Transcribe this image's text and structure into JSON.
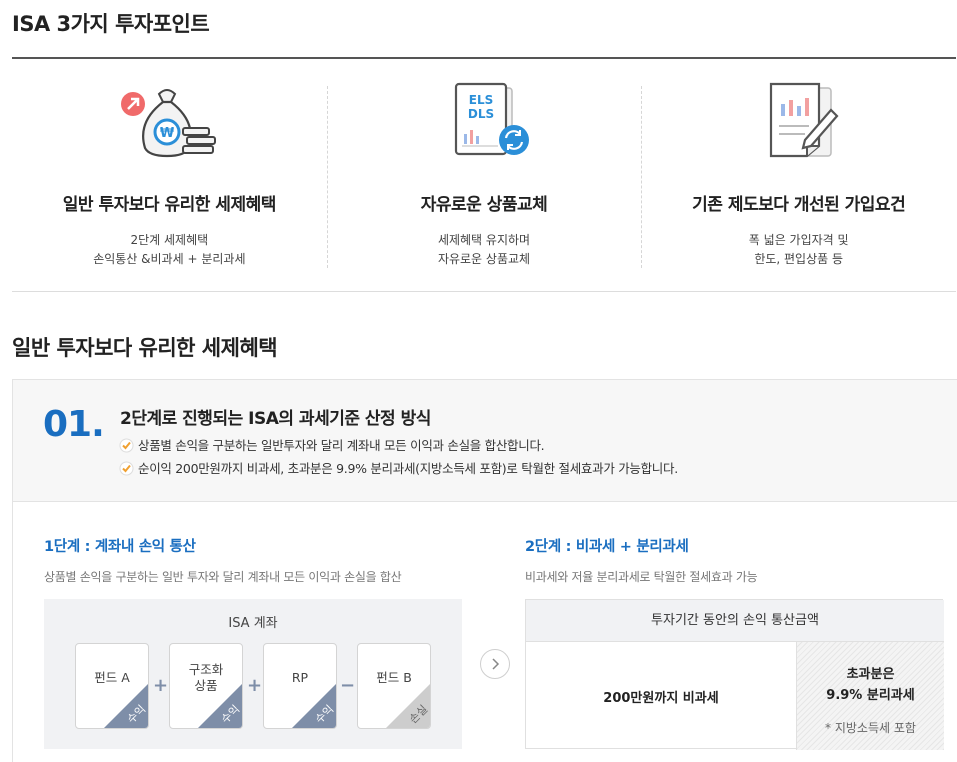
{
  "page_title": "ISA 3가지 투자포인트",
  "points": [
    {
      "heading": "일반 투자보다 유리한 세제혜택",
      "desc": [
        "2단계 세제혜택",
        "손익통산 &비과세 + 분리과세"
      ],
      "icon": "money-bag-icon"
    },
    {
      "heading": "자유로운 상품교체",
      "desc": [
        "세제혜택 유지하며",
        "자유로운 상품교체"
      ],
      "icon_text": [
        "ELS",
        "DLS"
      ],
      "icon": "els-dls-exchange-icon"
    },
    {
      "heading": "기존 제도보다 개선된 가입요건",
      "desc": [
        "폭 넓은 가입자격 및",
        "한도, 편입상품 등"
      ],
      "icon": "document-edit-icon"
    }
  ],
  "section_title": "일반 투자보다 유리한 세제혜택",
  "panel": {
    "step_no": "01.",
    "title": "2단계로 진행되는 ISA의 과세기준 산정 방식",
    "bullets": [
      "상품별 손익을 구분하는 일반투자와 달리 계좌내 모든 이익과 손실을 합산합니다.",
      "순이익 200만원까지 비과세, 초과분은 9.9% 분리과세(지방소득세 포함)로 탁월한 절세효과가 가능합니다."
    ],
    "stage1": {
      "title": "1단계 : 계좌내 손익 통산",
      "desc": "상품별 손익을 구분하는 일반 투자와 달리 계좌내 모든 이익과 손실을 합산",
      "box_label": "ISA 계좌",
      "cards": [
        {
          "label": "펀드 A",
          "tag": "수익",
          "kind": "gain"
        },
        {
          "label": "구조화\n상품",
          "tag": "수익",
          "kind": "gain"
        },
        {
          "label": "RP",
          "tag": "수익",
          "kind": "gain"
        },
        {
          "label": "펀드 B",
          "tag": "손실",
          "kind": "loss"
        }
      ],
      "ops": [
        "+",
        "+",
        "−"
      ]
    },
    "stage2": {
      "title": "2단계 : 비과세 + 분리과세",
      "desc": "비과세와 저율 분리과세로 탁월한 절세효과 가능",
      "head": "투자기간 동안의 손익 통산금액",
      "left": "200만원까지 비과세",
      "right_line1": "초과분은",
      "right_line2": "9.9% 분리과세",
      "note": "* 지방소득세 포함"
    }
  },
  "colors": {
    "accent_blue": "#1a6ec0",
    "check_orange": "#f0a030",
    "gain_corner": "#7e8ea8",
    "loss_corner": "#cdcdcd"
  }
}
